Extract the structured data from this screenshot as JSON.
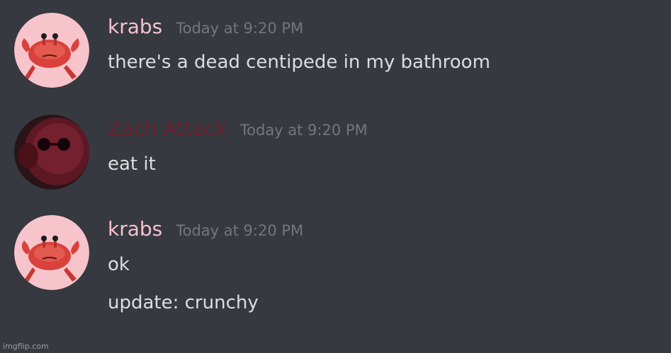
{
  "messages": [
    {
      "username": "krabs",
      "username_color": "#f5c1cf",
      "avatar_icon": "crab-avatar-icon",
      "timestamp": "Today at 9:20 PM",
      "lines": [
        "there's a dead centipede in my bathroom"
      ]
    },
    {
      "username": "Zach Attack",
      "username_color": "#6b1f2c",
      "avatar_icon": "dark-red-creature-avatar-icon",
      "timestamp": "Today at 9:20 PM",
      "lines": [
        "eat it"
      ]
    },
    {
      "username": "krabs",
      "username_color": "#f5c1cf",
      "avatar_icon": "crab-avatar-icon",
      "timestamp": "Today at 9:20 PM",
      "lines": [
        "ok",
        "update: crunchy"
      ]
    }
  ],
  "watermark": "imgflip.com",
  "colors": {
    "background": "#36393f",
    "message_text": "#dcddde",
    "timestamp": "#72767d"
  }
}
